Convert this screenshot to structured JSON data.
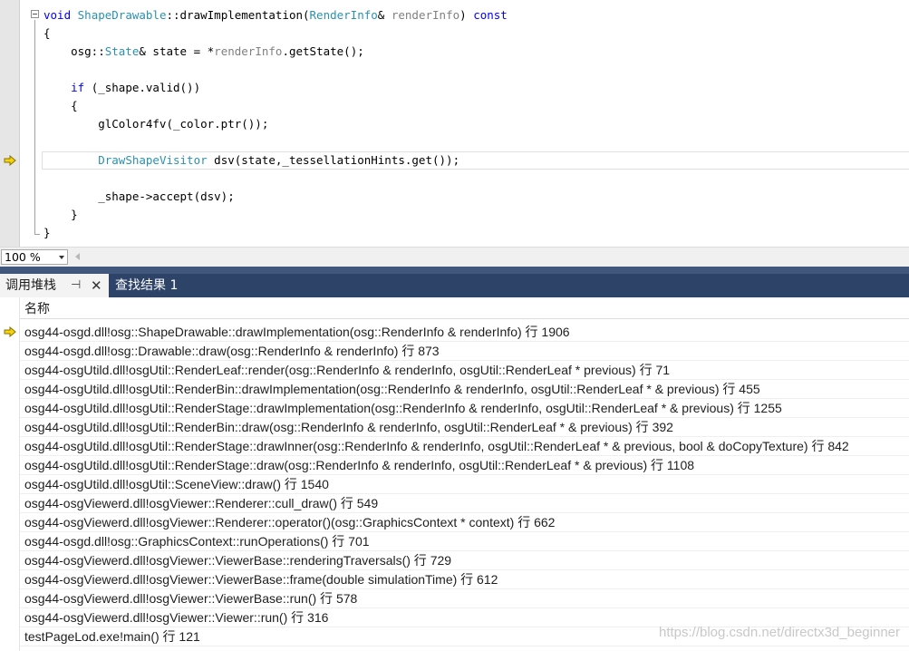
{
  "editor": {
    "lines": [
      {
        "segments": [
          {
            "t": "void",
            "c": "kw"
          },
          {
            "t": " "
          },
          {
            "t": "ShapeDrawable",
            "c": "ty"
          },
          {
            "t": "::drawImplementation("
          },
          {
            "t": "RenderInfo",
            "c": "ty"
          },
          {
            "t": "& "
          },
          {
            "t": "renderInfo",
            "c": "pm"
          },
          {
            "t": ") "
          },
          {
            "t": "const",
            "c": "kw"
          }
        ]
      },
      {
        "segments": [
          {
            "t": "{"
          }
        ]
      },
      {
        "segments": [
          {
            "t": "    osg::"
          },
          {
            "t": "State",
            "c": "ty"
          },
          {
            "t": "& state = *"
          },
          {
            "t": "renderInfo",
            "c": "pm"
          },
          {
            "t": ".getState();"
          }
        ]
      },
      {
        "segments": [
          {
            "t": ""
          }
        ]
      },
      {
        "segments": [
          {
            "t": "    "
          },
          {
            "t": "if",
            "c": "kw"
          },
          {
            "t": " (_shape.valid())"
          }
        ]
      },
      {
        "segments": [
          {
            "t": "    {"
          }
        ]
      },
      {
        "segments": [
          {
            "t": "        glColor4fv(_color.ptr());"
          }
        ]
      },
      {
        "segments": [
          {
            "t": ""
          }
        ]
      },
      {
        "segments": [
          {
            "t": "        "
          },
          {
            "t": "DrawShapeVisitor",
            "c": "ty"
          },
          {
            "t": " dsv(state,_tessellationHints.get());"
          }
        ]
      },
      {
        "segments": [
          {
            "t": ""
          }
        ]
      },
      {
        "segments": [
          {
            "t": "        _shape->accept(dsv);"
          }
        ]
      },
      {
        "segments": [
          {
            "t": "    }"
          }
        ]
      },
      {
        "segments": [
          {
            "t": "}"
          }
        ]
      }
    ]
  },
  "zoom": {
    "value": "100 %"
  },
  "tabs": {
    "callstack_label": "调用堆栈",
    "find_label": "查找结果 1",
    "pin_icon": "pin-icon",
    "close_icon": "close-icon"
  },
  "callstack": {
    "column_header": "名称",
    "current_marker_icon": "current-frame-arrow-icon",
    "frames": [
      "osg44-osgd.dll!osg::ShapeDrawable::drawImplementation(osg::RenderInfo & renderInfo) 行 1906",
      "osg44-osgd.dll!osg::Drawable::draw(osg::RenderInfo & renderInfo) 行 873",
      "osg44-osgUtild.dll!osgUtil::RenderLeaf::render(osg::RenderInfo & renderInfo, osgUtil::RenderLeaf * previous) 行 71",
      "osg44-osgUtild.dll!osgUtil::RenderBin::drawImplementation(osg::RenderInfo & renderInfo, osgUtil::RenderLeaf * & previous) 行 455",
      "osg44-osgUtild.dll!osgUtil::RenderStage::drawImplementation(osg::RenderInfo & renderInfo, osgUtil::RenderLeaf * & previous) 行 1255",
      "osg44-osgUtild.dll!osgUtil::RenderBin::draw(osg::RenderInfo & renderInfo, osgUtil::RenderLeaf * & previous) 行 392",
      "osg44-osgUtild.dll!osgUtil::RenderStage::drawInner(osg::RenderInfo & renderInfo, osgUtil::RenderLeaf * & previous, bool & doCopyTexture) 行 842",
      "osg44-osgUtild.dll!osgUtil::RenderStage::draw(osg::RenderInfo & renderInfo, osgUtil::RenderLeaf * & previous) 行 1108",
      "osg44-osgUtild.dll!osgUtil::SceneView::draw() 行 1540",
      "osg44-osgViewerd.dll!osgViewer::Renderer::cull_draw() 行 549",
      "osg44-osgViewerd.dll!osgViewer::Renderer::operator()(osg::GraphicsContext * context) 行 662",
      "osg44-osgd.dll!osg::GraphicsContext::runOperations() 行 701",
      "osg44-osgViewerd.dll!osgViewer::ViewerBase::renderingTraversals() 行 729",
      "osg44-osgViewerd.dll!osgViewer::ViewerBase::frame(double simulationTime) 行 612",
      "osg44-osgViewerd.dll!osgViewer::ViewerBase::run() 行 578",
      "osg44-osgViewerd.dll!osgViewer::Viewer::run() 行 316",
      "testPageLod.exe!main() 行 121"
    ]
  },
  "watermark": "https://blog.csdn.net/directx3d_beginner",
  "colors": {
    "tab_bar": "#2d4468",
    "keyword": "#0000ff",
    "type": "#2b91af",
    "param": "#808080",
    "arrow": "#f5d40b"
  }
}
